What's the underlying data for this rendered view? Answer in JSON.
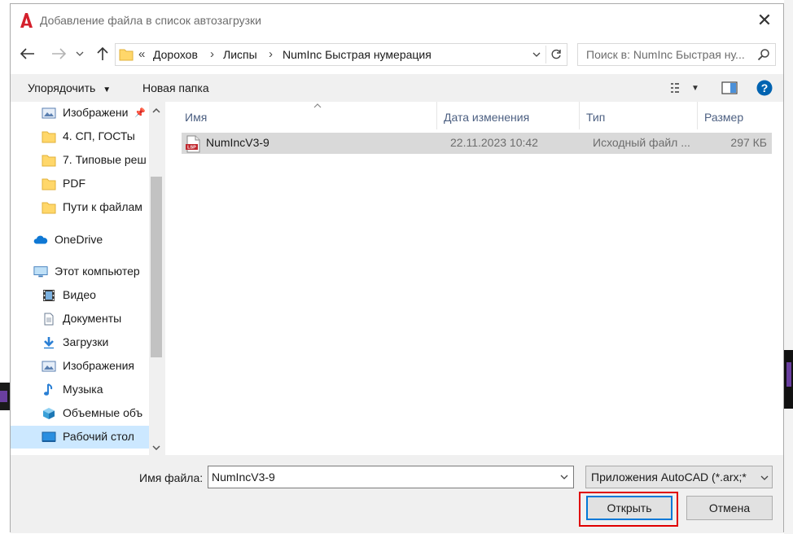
{
  "dialog": {
    "title": "Добавление файла в список автозагрузки",
    "close_icon": "close-icon"
  },
  "nav": {
    "back_icon": "back-arrow-icon",
    "forward_icon": "forward-arrow-icon",
    "recent_icon": "chevron-down-icon",
    "up_icon": "up-arrow-icon"
  },
  "address": {
    "overflow": "«",
    "crumbs": [
      "Дорохов",
      "Лиспы",
      "NumInc Быстрая нумерация"
    ]
  },
  "search": {
    "placeholder": "Поиск в: NumInc Быстрая ну..."
  },
  "toolbar": {
    "organize_label": "Упорядочить",
    "new_folder_label": "Новая папка"
  },
  "sidebar": {
    "items": [
      {
        "label": "Изображени",
        "icon": "pictures-icon",
        "pinned": true
      },
      {
        "label": "4. СП, ГОСТы",
        "icon": "folder-icon"
      },
      {
        "label": "7. Типовые реш",
        "icon": "folder-icon"
      },
      {
        "label": "PDF",
        "icon": "folder-icon"
      },
      {
        "label": "Пути к файлам",
        "icon": "folder-icon"
      },
      {
        "label": "OneDrive",
        "icon": "cloud-icon"
      },
      {
        "label": "Этот компьютер",
        "icon": "computer-icon"
      },
      {
        "label": "Видео",
        "icon": "video-icon"
      },
      {
        "label": "Документы",
        "icon": "document-icon"
      },
      {
        "label": "Загрузки",
        "icon": "download-icon"
      },
      {
        "label": "Изображения",
        "icon": "pictures-icon"
      },
      {
        "label": "Музыка",
        "icon": "music-icon"
      },
      {
        "label": "Объемные объ",
        "icon": "3d-objects-icon"
      },
      {
        "label": "Рабочий стол",
        "icon": "desktop-icon",
        "selected": true
      }
    ]
  },
  "files": {
    "columns": [
      "Имя",
      "Дата изменения",
      "Тип",
      "Размер"
    ],
    "rows": [
      {
        "name": "NumIncV3-9",
        "date": "22.11.2023 10:42",
        "type": "Исходный файл ...",
        "size": "297 КБ",
        "icon": "lsp-file-icon"
      }
    ]
  },
  "footer": {
    "filename_label": "Имя файла:",
    "filename_value": "NumIncV3-9",
    "filetype": "Приложения AutoCAD (*.arx;*",
    "open_label": "Открыть",
    "cancel_label": "Отмена"
  },
  "colors": {
    "selection": "#cce8ff",
    "row_selected": "#d9d9d9",
    "highlight_box": "#e00000",
    "help": "#0063b1"
  }
}
